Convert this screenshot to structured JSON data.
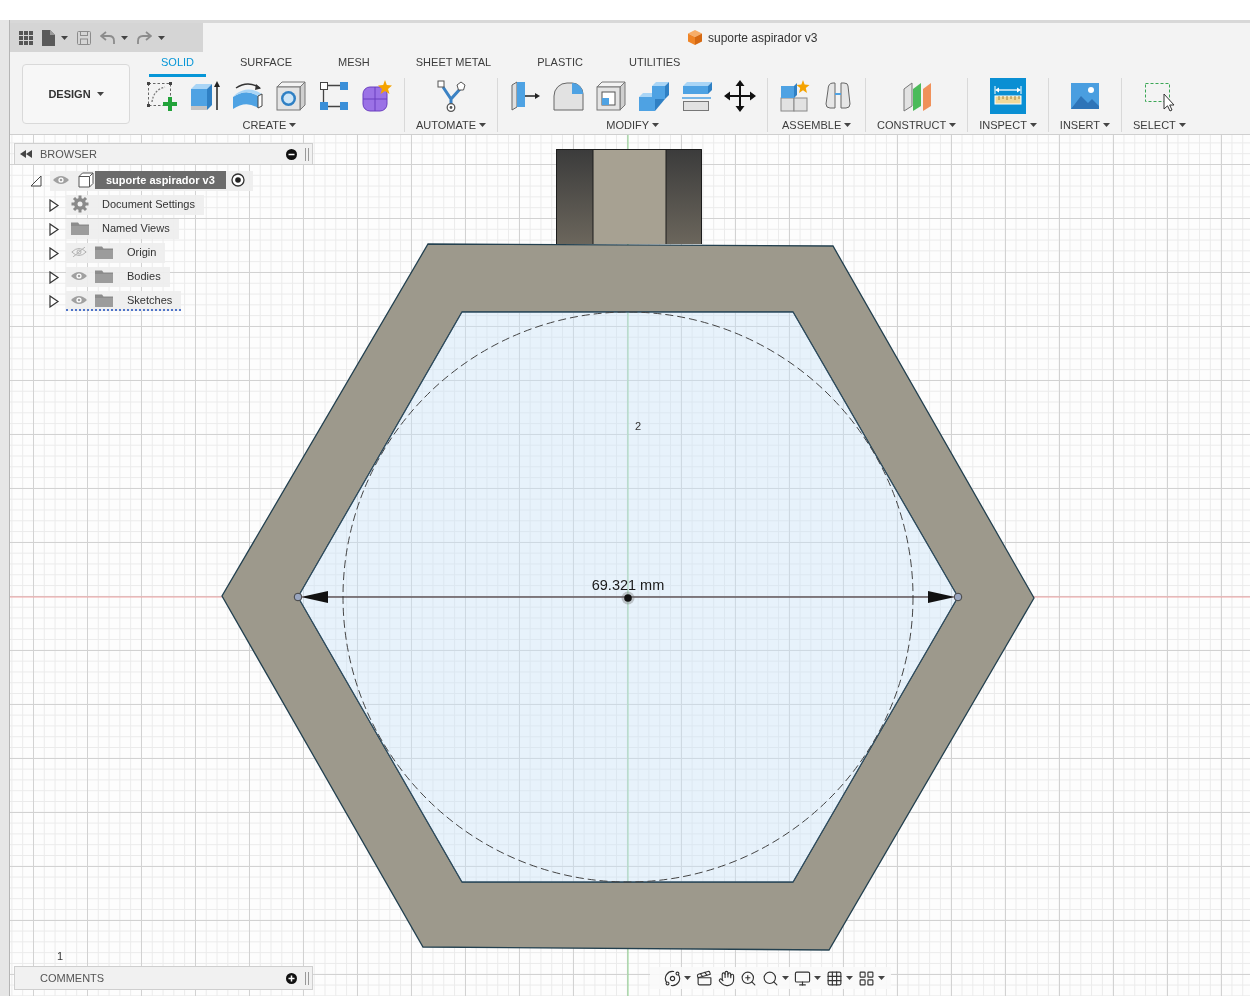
{
  "document": {
    "title": "suporte aspirador v3"
  },
  "workspace": {
    "label": "DESIGN"
  },
  "tabs": [
    {
      "label": "SOLID",
      "selected": true
    },
    {
      "label": "SURFACE",
      "selected": false
    },
    {
      "label": "MESH",
      "selected": false
    },
    {
      "label": "SHEET METAL",
      "selected": false
    },
    {
      "label": "PLASTIC",
      "selected": false
    },
    {
      "label": "UTILITIES",
      "selected": false
    }
  ],
  "tool_groups": [
    {
      "label": "CREATE"
    },
    {
      "label": "AUTOMATE"
    },
    {
      "label": "MODIFY"
    },
    {
      "label": "ASSEMBLE"
    },
    {
      "label": "CONSTRUCT"
    },
    {
      "label": "INSPECT"
    },
    {
      "label": "INSERT"
    },
    {
      "label": "SELECT"
    }
  ],
  "browser": {
    "title": "BROWSER",
    "root": {
      "label": "suporte aspirador v3",
      "expanded": true,
      "visible": true,
      "selected": true,
      "active": true,
      "children": [
        {
          "label": "Document Settings",
          "kind": "settings",
          "expanded": false,
          "flagged": false
        },
        {
          "label": "Named Views",
          "kind": "views",
          "expanded": false,
          "flagged": false
        },
        {
          "label": "Origin",
          "kind": "folder",
          "expanded": false,
          "visible": false,
          "flagged": false
        },
        {
          "label": "Bodies",
          "kind": "folder",
          "expanded": false,
          "visible": true,
          "flagged": false
        },
        {
          "label": "Sketches",
          "kind": "folder",
          "expanded": false,
          "visible": true,
          "flagged": true
        }
      ]
    }
  },
  "canvas": {
    "dimension": "69.321 mm",
    "labels": [
      "2",
      "1"
    ]
  },
  "comments": {
    "title": "COMMENTS"
  }
}
